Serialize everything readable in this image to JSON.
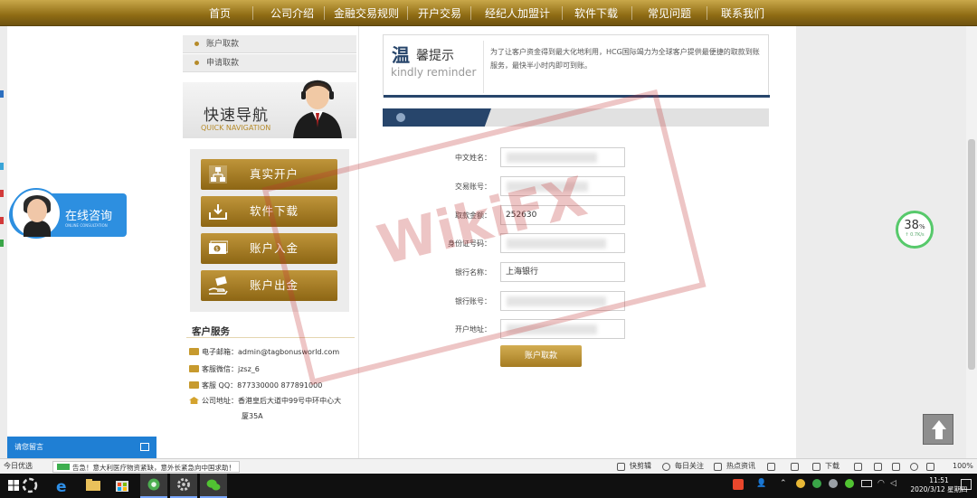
{
  "nav": {
    "items": [
      "首页",
      "公司介绍",
      "金融交易规则",
      "开户交易",
      "经纪人加盟计划",
      "软件下载",
      "常见问题",
      "联系我们"
    ]
  },
  "sidebar": {
    "sub_items": [
      "账户取款",
      "申请取款"
    ],
    "quick_nav_title": "快速导航",
    "quick_nav_subtitle": "QUICK NAVIGATION",
    "buttons": [
      {
        "label": "真实开户",
        "icon": "account-tree-icon"
      },
      {
        "label": "软件下载",
        "icon": "download-tray-icon"
      },
      {
        "label": "账户入金",
        "icon": "cash-deposit-icon"
      },
      {
        "label": "账户出金",
        "icon": "hand-withdraw-icon"
      }
    ],
    "customer_service": {
      "title": "客户服务",
      "email": "电子邮箱：admin@tagbonusworld.com",
      "wechat": "客服微信：jzsz_6",
      "qq": "客服   QQ：877330000    877891000",
      "address_line1": "公司地址：香港皇后大道中99号中环中心大",
      "address_line2": "厦35A"
    }
  },
  "reminder": {
    "title_big": "温",
    "title_rest": "馨提示",
    "subtitle": "kindly reminder",
    "text": "为了让客户资金得到最大化地利用，HCG国际竭力为全球客户提供最便捷的取款到账服务，最快半小时内即可到账。"
  },
  "form": {
    "fields": [
      {
        "label": "中文姓名：",
        "value": ""
      },
      {
        "label": "交易账号：",
        "value": ""
      },
      {
        "label": "取款金额：",
        "value": "252630"
      },
      {
        "label": "身份证号码：",
        "value": ""
      },
      {
        "label": "银行名称：",
        "value": "上海银行"
      },
      {
        "label": "银行账号：",
        "value": ""
      },
      {
        "label": "开户地址：",
        "value": ""
      }
    ],
    "submit_label": "账户取款"
  },
  "watermark": {
    "text": "WikiFX"
  },
  "widgets": {
    "chat_label": "在线咨询",
    "chat_sub": "ONLINE CONSULTATION",
    "speed_percent": "38",
    "speed_unit": "%",
    "speed_sub": "↑ 0.7K/s",
    "leave_message": "请您留言"
  },
  "statusbar": {
    "left": "今日优选",
    "news": "告急！意大利医疗物资紧缺，意外长紧急向中国求助！",
    "items": [
      "快剪辑",
      "每日关注",
      "热点资讯",
      "下载",
      "100%"
    ]
  },
  "clock": {
    "time": "11:51",
    "date": "2020/3/12 星期四"
  },
  "colors": {
    "gold": "#b68b2a",
    "navy": "#27456b",
    "chat_blue": "#2d8fe0"
  }
}
